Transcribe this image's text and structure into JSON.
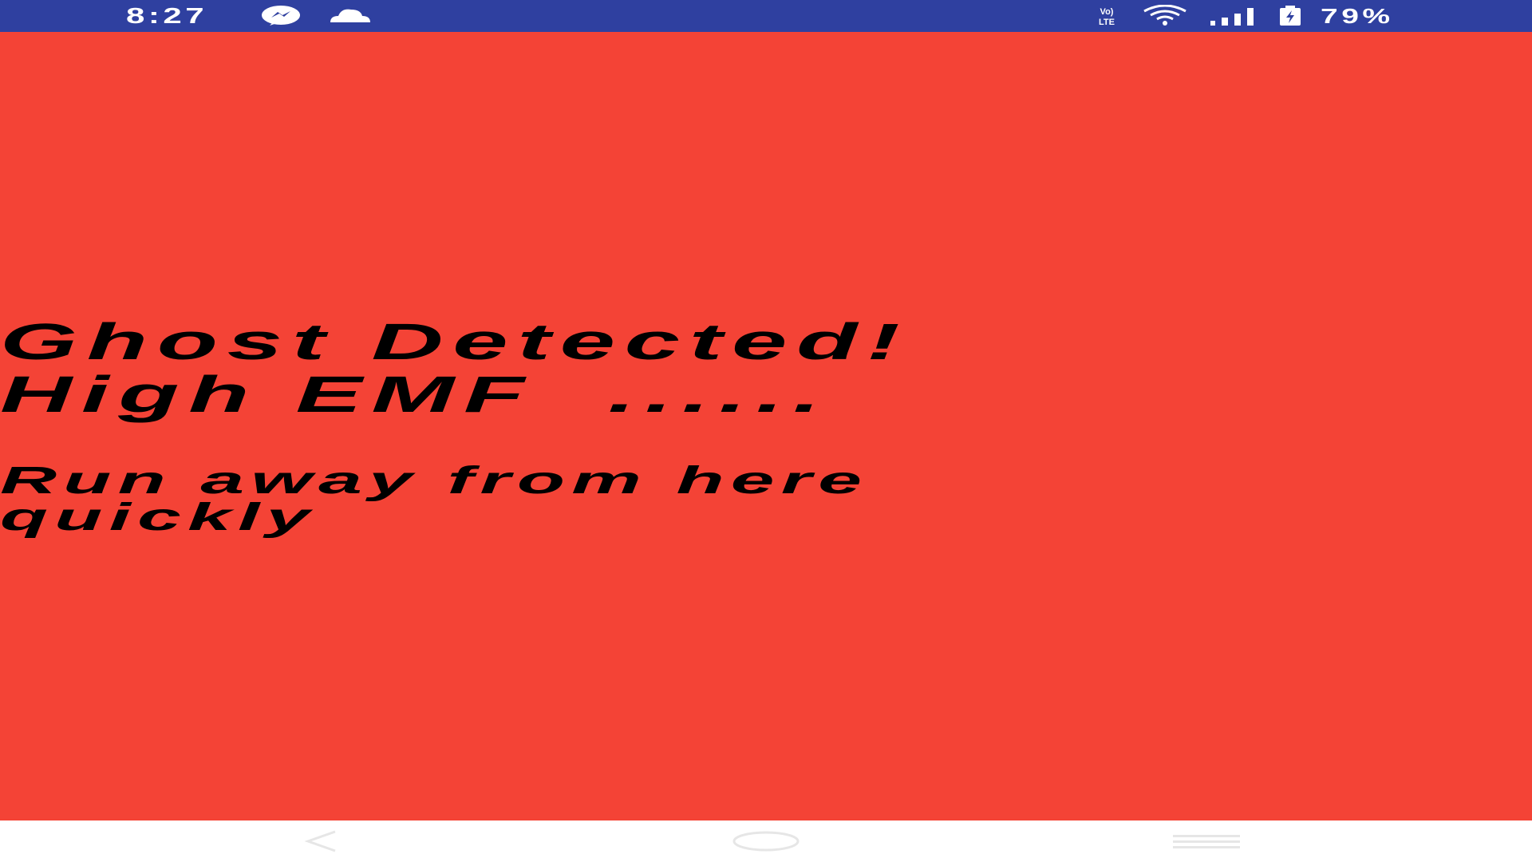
{
  "status_bar": {
    "time": "8:27",
    "battery_percent": "79%",
    "network_label": "Vo) LTE",
    "icons": [
      "messenger-icon",
      "cloud-icon",
      "volte-icon",
      "wifi-icon",
      "signal-icon",
      "battery-icon"
    ],
    "background_color": "#2f40a0"
  },
  "main": {
    "background_color": "#f44336",
    "headline": "Ghost Detected!\nHigh EMF  ......",
    "subline": "Run away from here\nquickly"
  },
  "nav_bar": {
    "buttons": [
      "back-button",
      "home-button",
      "recents-button"
    ]
  }
}
